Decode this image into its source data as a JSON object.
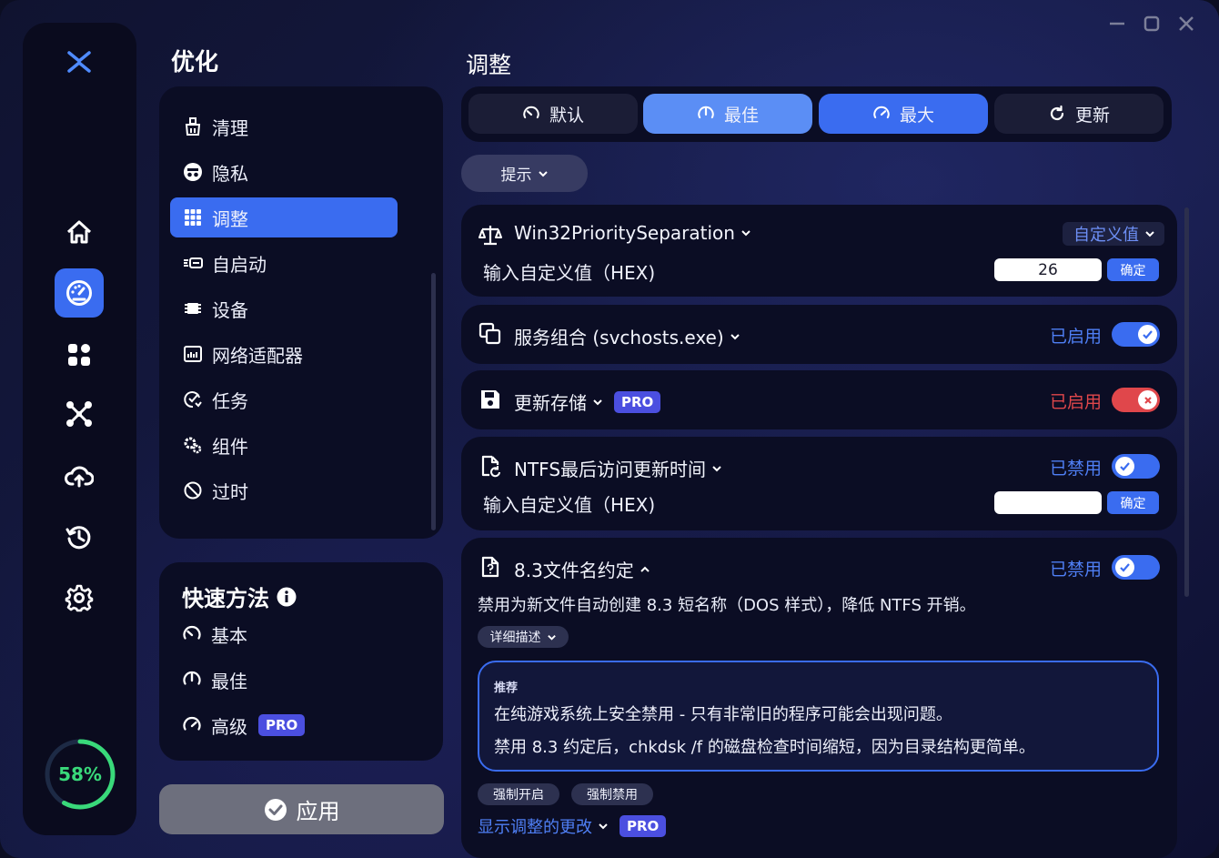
{
  "window": {
    "controls": [
      "minimize",
      "maximize",
      "close"
    ]
  },
  "rail": {
    "items": [
      {
        "name": "logo-icon"
      },
      {
        "name": "home-icon"
      },
      {
        "name": "speedometer-icon",
        "active": true
      },
      {
        "name": "apps-grid-icon"
      },
      {
        "name": "network-nodes-icon"
      },
      {
        "name": "cloud-upload-icon"
      },
      {
        "name": "history-icon"
      },
      {
        "name": "settings-gear-icon"
      }
    ],
    "progress": {
      "label": "58%",
      "value": 0.58
    }
  },
  "sidebar": {
    "title": "优化",
    "items": [
      {
        "label": "清理",
        "icon": "broom-icon"
      },
      {
        "label": "隐私",
        "icon": "incognito-icon"
      },
      {
        "label": "调整",
        "icon": "grid-icon",
        "active": true
      },
      {
        "label": "自启动",
        "icon": "startup-icon"
      },
      {
        "label": "设备",
        "icon": "chip-icon"
      },
      {
        "label": "网络适配器",
        "icon": "network-adapter-icon"
      },
      {
        "label": "任务",
        "icon": "task-icon"
      },
      {
        "label": "组件",
        "icon": "components-gear-icon"
      },
      {
        "label": "过时",
        "icon": "ban-icon"
      }
    ]
  },
  "quick": {
    "title": "快速方法",
    "items": [
      {
        "label": "基本",
        "icon": "gauge-low-icon"
      },
      {
        "label": "最佳",
        "icon": "gauge-mid-icon"
      },
      {
        "label": "高级",
        "icon": "gauge-high-icon",
        "badge": "PRO"
      }
    ]
  },
  "apply": {
    "label": "应用"
  },
  "main": {
    "title": "调整",
    "presets": [
      {
        "label": "默认",
        "icon": "gauge-low-icon"
      },
      {
        "label": "最佳",
        "icon": "gauge-mid-icon"
      },
      {
        "label": "最大",
        "icon": "gauge-high-icon"
      },
      {
        "label": "更新",
        "icon": "refresh-icon"
      }
    ],
    "hint": {
      "label": "提示"
    },
    "tweaks": [
      {
        "title": "Win32PrioritySeparation",
        "select": "自定义值",
        "custom_label": "输入自定义值（HEX)",
        "input_value": "26",
        "ok": "确定"
      },
      {
        "title": "服务组合 (svchosts.exe)",
        "status": "已启用",
        "toggle_on": true,
        "status_color": "#4f7ff5"
      },
      {
        "title": "更新存储",
        "badge": "PRO",
        "status": "已启用",
        "toggle_on": false,
        "status_color": "#e0474b"
      },
      {
        "title": "NTFS最后访问更新时间",
        "status": "已禁用",
        "toggle_on": true,
        "custom_label": "输入自定义值（HEX)",
        "input_value": "",
        "ok": "确定"
      },
      {
        "title": "8.3文件名约定",
        "status": "已禁用",
        "toggle_on": true,
        "description": "禁用为新文件自动创建 8.3 短名称（DOS 样式），降低 NTFS 开销。",
        "details_label": "详细描述",
        "rec_title": "推荐",
        "rec_line1": "在纯游戏系统上安全禁用 - 只有非常旧的程序可能会出现问题。",
        "rec_line2": "禁用 8.3 约定后，chkdsk /f 的磁盘检查时间缩短，因为目录结构更简单。",
        "force_on": "强制开启",
        "force_off": "强制禁用",
        "show_changes": "显示调整的更改",
        "show_changes_badge": "PRO"
      }
    ]
  },
  "colors": {
    "accent": "#3a6cf0",
    "accent_light": "#5b8ef5",
    "status_enabled": "#4f7ff5",
    "status_danger": "#e0474b",
    "progress": "#39d97a",
    "pro_badge": "#4b4fe0"
  }
}
